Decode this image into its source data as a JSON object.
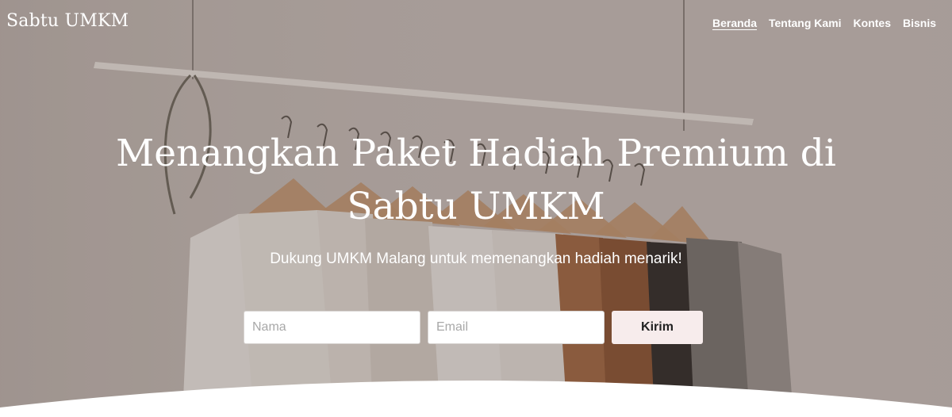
{
  "navbar": {
    "brand": "Sabtu UMKM",
    "links": [
      {
        "label": "Beranda",
        "active": true
      },
      {
        "label": "Tentang Kami",
        "active": false
      },
      {
        "label": "Kontes",
        "active": false
      },
      {
        "label": "Bisnis",
        "active": false
      }
    ]
  },
  "hero": {
    "headline": "Menangkan Paket Hadiah Premium di Sabtu UMKM",
    "subtitle": "Dukung UMKM Malang untuk memenangkan hadiah menarik!"
  },
  "form": {
    "name_placeholder": "Nama",
    "email_placeholder": "Email",
    "submit_label": "Kirim"
  },
  "colors": {
    "text": "#ffffff",
    "button_bg": "#f7ecec",
    "background": "#ffffff"
  }
}
